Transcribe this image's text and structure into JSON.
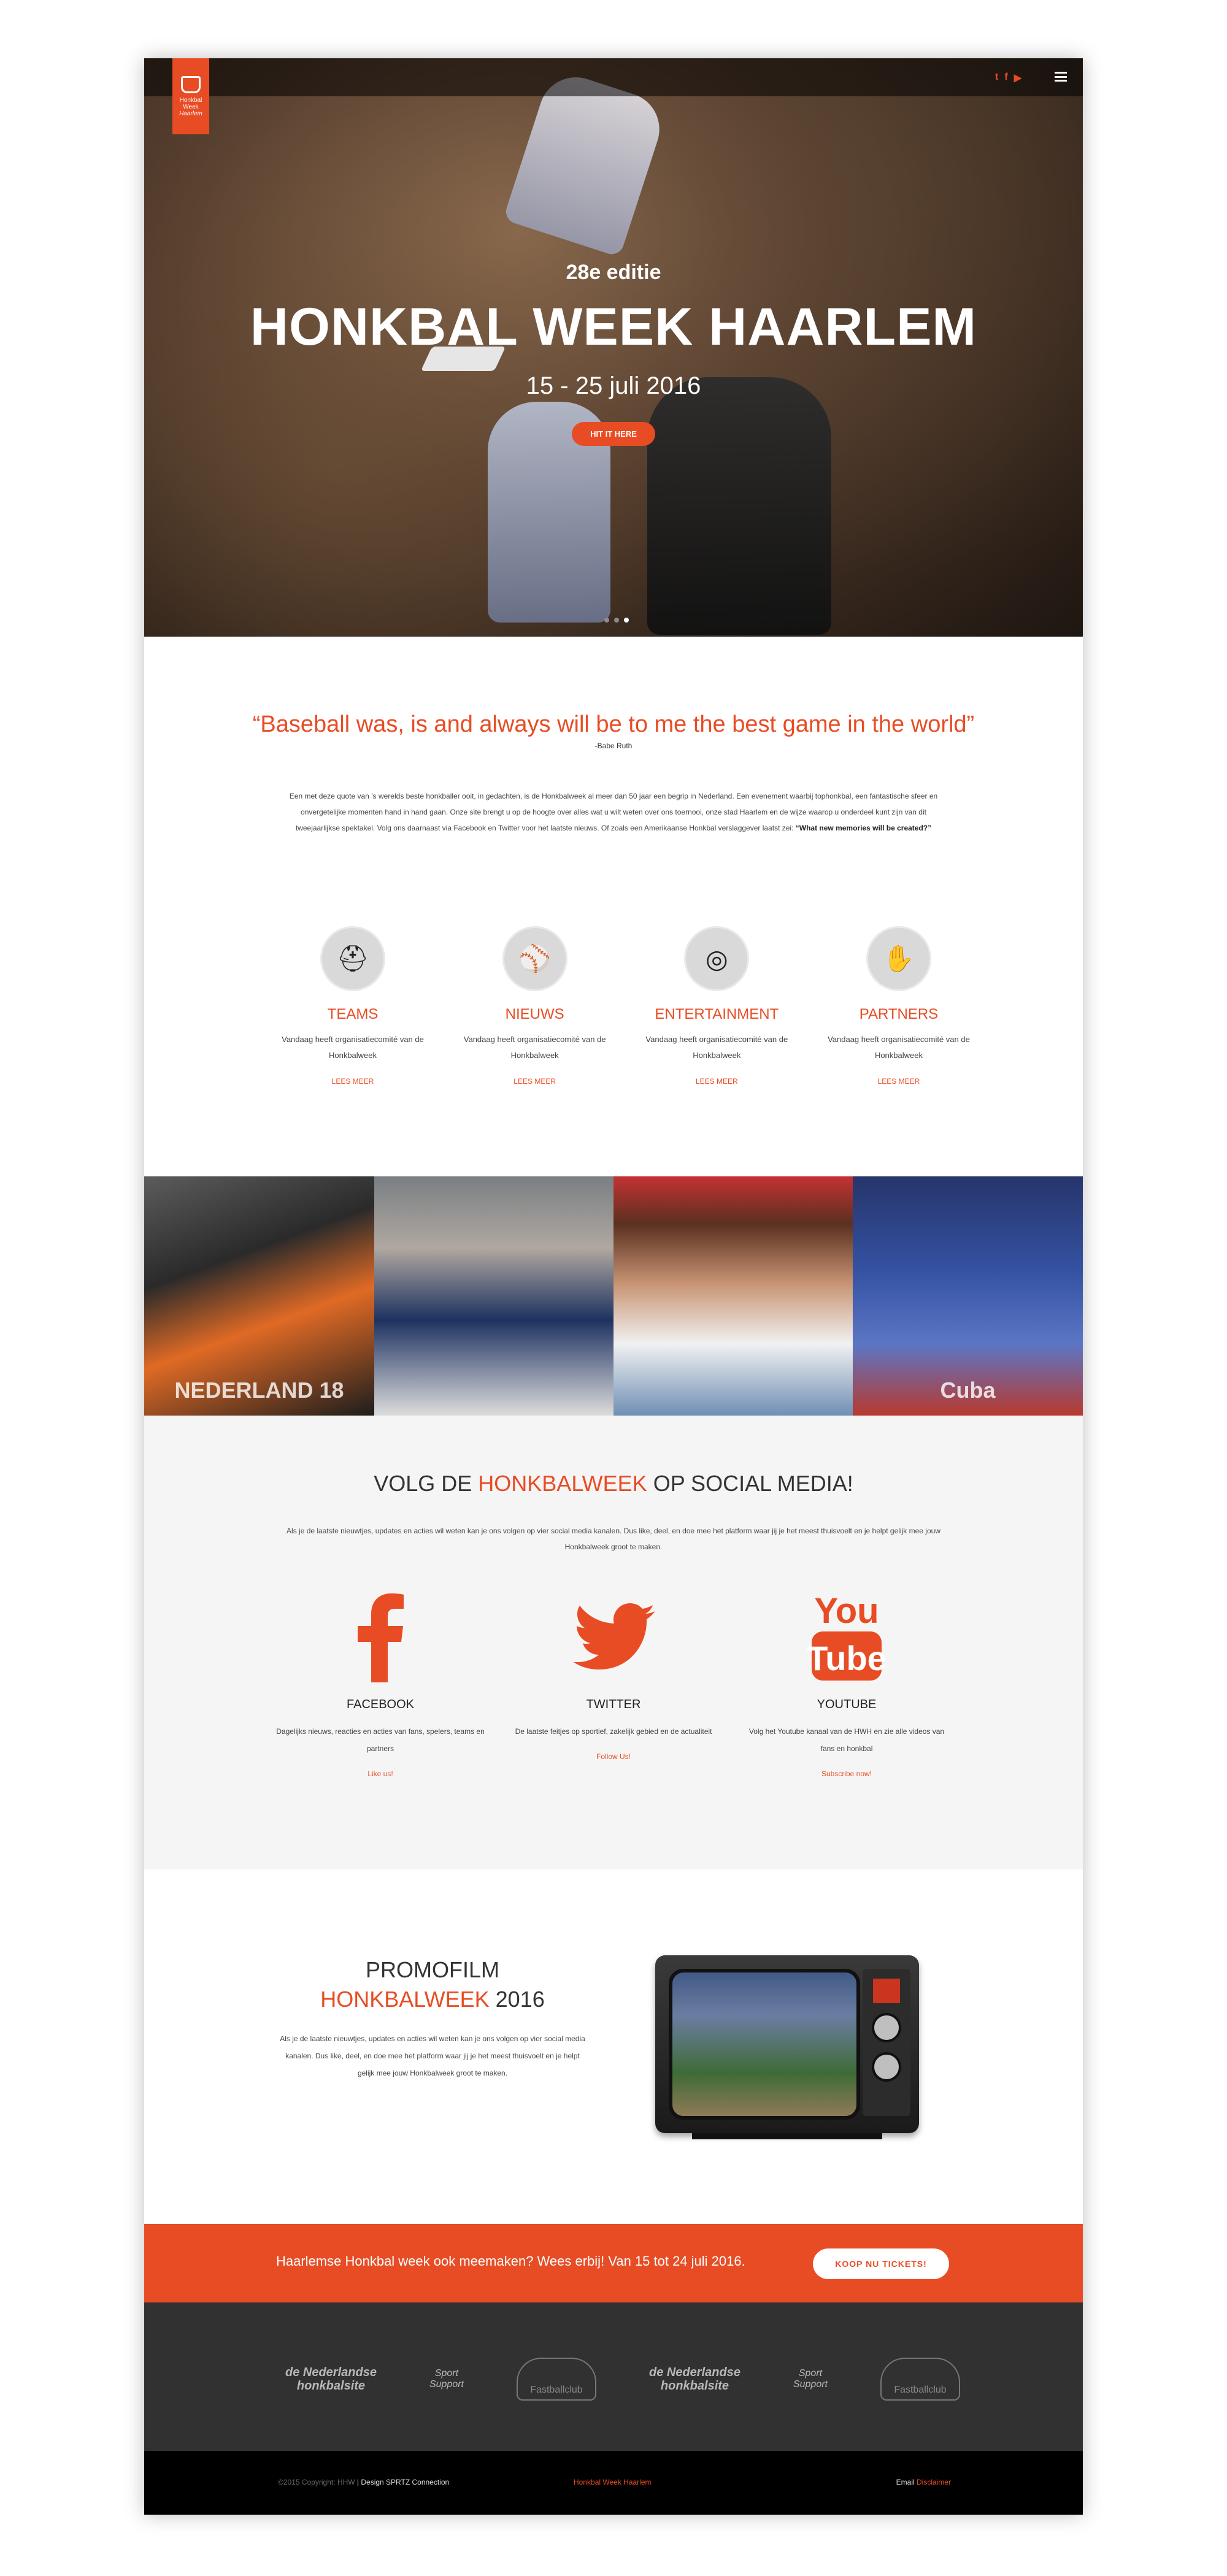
{
  "hero": {
    "logo_lines": [
      "Honkbal",
      "Week",
      "Haarlem"
    ],
    "social": [
      "t",
      "f",
      "▶"
    ],
    "edition": "28e editie",
    "title": "HONKBAL WEEK HAARLEM",
    "dates": "15 - 25 juli 2016",
    "button": "HIT IT HERE",
    "slides": 3,
    "active_slide": 3
  },
  "quote": {
    "text": "“Baseball was, is and always will be to me the best game in the world”",
    "author": "-Babe Ruth"
  },
  "intro": {
    "text": "Een met deze quote van ’s werelds beste honkballer ooit, in gedachten, is de Honkbalweek al meer dan 50 jaar een begrip in Nederland. Een evenement waarbij tophonkbal, een fantastische sfeer en onvergetelijke momenten hand in hand gaan. Onze site brengt u op de hoogte over alles wat u wilt weten over ons toernooi, onze stad Haarlem en de wijze waarop u onderdeel kunt zijn van dit tweejaarlijkse spektakel. Volg ons daarnaast via Facebook en Twitter voor het laatste nieuws. Of zoals een Amerikaanse Honkbal verslaggever laatst zei: ",
    "bold": "“What new memories will be created?”"
  },
  "features": [
    {
      "icon": "⛑",
      "title": "TEAMS",
      "text": "Vandaag heeft organisatiecomité van de Honkbalweek",
      "more": "LEES MEER"
    },
    {
      "icon": "⚾",
      "title": "NIEUWS",
      "text": "Vandaag heeft organisatiecomité van de Honkbalweek",
      "more": "LEES MEER"
    },
    {
      "icon": "◎",
      "title": "ENTERTAINMENT",
      "text": "Vandaag heeft organisatiecomité van de Honkbalweek",
      "more": "LEES MEER"
    },
    {
      "icon": "✋",
      "title": "PARTNERS",
      "text": "Vandaag heeft organisatiecomité van de Honkbalweek",
      "more": "LEES MEER"
    }
  ],
  "photos": [
    {
      "overlay": "NEDERLAND 18"
    },
    {
      "overlay": ""
    },
    {
      "overlay": ""
    },
    {
      "overlay": "Cuba"
    }
  ],
  "social": {
    "title_pre": "VOLG DE ",
    "title_hl": "HONKBALWEEK",
    "title_post": " OP SOCIAL MEDIA!",
    "lead": "Als je de laatste nieuwtjes, updates en acties wil weten kan je ons volgen op vier social media kanalen. Dus like, deel, en doe mee het platform waar jij je het meest thuisvoelt en je helpt gelijk mee jouw Honkbalweek groot te maken.",
    "cols": [
      {
        "name": "FACEBOOK",
        "text": "Dagelijks nieuws, reacties en acties van fans, spelers, teams en partners",
        "link": "Like us!"
      },
      {
        "name": "TWITTER",
        "text": "De laatste feitjes op sportief, zakelijk gebied en de actualiteit",
        "link": "Follow Us!"
      },
      {
        "name": "YOUTUBE",
        "text": "Volg het Youtube kanaal van de HWH en zie alle videos van fans en honkbal",
        "link": "Subscribe now!"
      }
    ]
  },
  "promo": {
    "title1": "PROMOFILM",
    "title_hl": "HONKBALWEEK",
    "title_year": " 2016",
    "text": "Als je de laatste nieuwtjes, updates en acties wil weten kan je ons volgen op vier social media kanalen. Dus like, deel, en doe mee het platform waar jij je het meest thuisvoelt en je helpt gelijk mee jouw Honkbalweek groot te maken."
  },
  "cta": {
    "text": "Haarlemse Honkbal week ook meemaken? Wees erbij! Van 15 tot 24 juli 2016.",
    "button": "KOOP NU TICKETS!"
  },
  "sponsors": [
    {
      "line1": "de Nederlandse",
      "line2": "honkbalsite"
    },
    {
      "line1": "Sport",
      "line2": "Support"
    },
    {
      "line1": "Fastballclub",
      "line2": ""
    },
    {
      "line1": "de Nederlandse",
      "line2": "honkbalsite"
    },
    {
      "line1": "Sport",
      "line2": "Support"
    },
    {
      "line1": "Fastballclub",
      "line2": ""
    }
  ],
  "footer": {
    "copyright": "©2015 Copyright: HHW",
    "design": " | Design SPRTZ Connection",
    "center": "Honkbal Week Haarlem",
    "email_label": "Email ",
    "disclaimer": "Disclaimer"
  },
  "colors": {
    "accent": "#e84c24",
    "dark": "#313131",
    "light_bg": "#f5f5f5"
  }
}
